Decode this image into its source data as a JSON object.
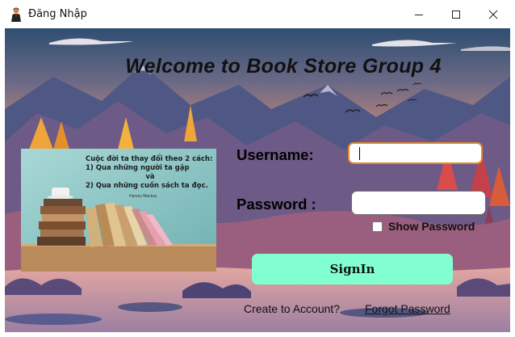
{
  "window": {
    "title": "Đăng Nhập",
    "minimize_icon": "minimize-icon",
    "maximize_icon": "maximize-icon",
    "close_icon": "close-icon"
  },
  "main": {
    "welcome": "Welcome to Book Store Group 4",
    "quote_lines": [
      "Cuộc đời ta thay đổi theo 2 cách:",
      "1) Qua những người ta gặp",
      "và",
      "2) Qua những cuốn sách ta đọc."
    ],
    "quote_author": "Harvey Mackay",
    "username_label": "Username:",
    "username_value": "",
    "password_label": "Password :",
    "password_value": "",
    "show_password_label": "Show Password",
    "show_password_checked": false,
    "signin_label": "SignIn",
    "create_account_link": "Create to Account?",
    "forgot_password_link": "Forgot Password"
  },
  "colors": {
    "signin_button": "#82ffd0",
    "focused_input_border": "#e08a2c"
  }
}
